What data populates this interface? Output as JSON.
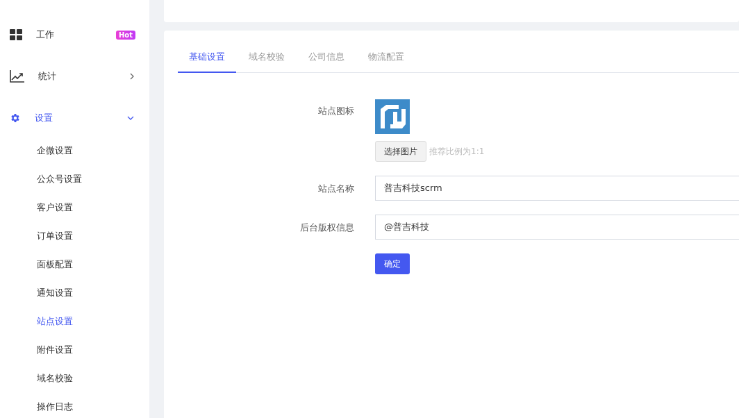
{
  "sidebar": {
    "items": [
      {
        "kind": "grid",
        "label": "工作",
        "badge": "Hot",
        "active": false
      },
      {
        "kind": "chart",
        "label": "统计",
        "expanded": false,
        "active": false
      },
      {
        "kind": "gear",
        "label": "设置",
        "expanded": true,
        "active": true,
        "children": [
          {
            "label": "企微设置",
            "selected": false
          },
          {
            "label": "公众号设置",
            "selected": false
          },
          {
            "label": "客户设置",
            "selected": false
          },
          {
            "label": "订单设置",
            "selected": false
          },
          {
            "label": "面板配置",
            "selected": false
          },
          {
            "label": "通知设置",
            "selected": false
          },
          {
            "label": "站点设置",
            "selected": true
          },
          {
            "label": "附件设置",
            "selected": false
          },
          {
            "label": "域名校验",
            "selected": false
          },
          {
            "label": "操作日志",
            "selected": false
          }
        ]
      }
    ]
  },
  "tabs": [
    {
      "label": "基础设置",
      "selected": true
    },
    {
      "label": "域名校验",
      "selected": false
    },
    {
      "label": "公司信息",
      "selected": false
    },
    {
      "label": "物流配置",
      "selected": false
    }
  ],
  "form": {
    "icon": {
      "label": "站点图标",
      "button": "选择图片",
      "hint": "推荐比例为1:1"
    },
    "fields": [
      {
        "label": "站点名称",
        "value": "普吉科技scrm"
      },
      {
        "label": "后台版权信息",
        "value": "@普吉科技"
      }
    ],
    "submit": "确定"
  }
}
